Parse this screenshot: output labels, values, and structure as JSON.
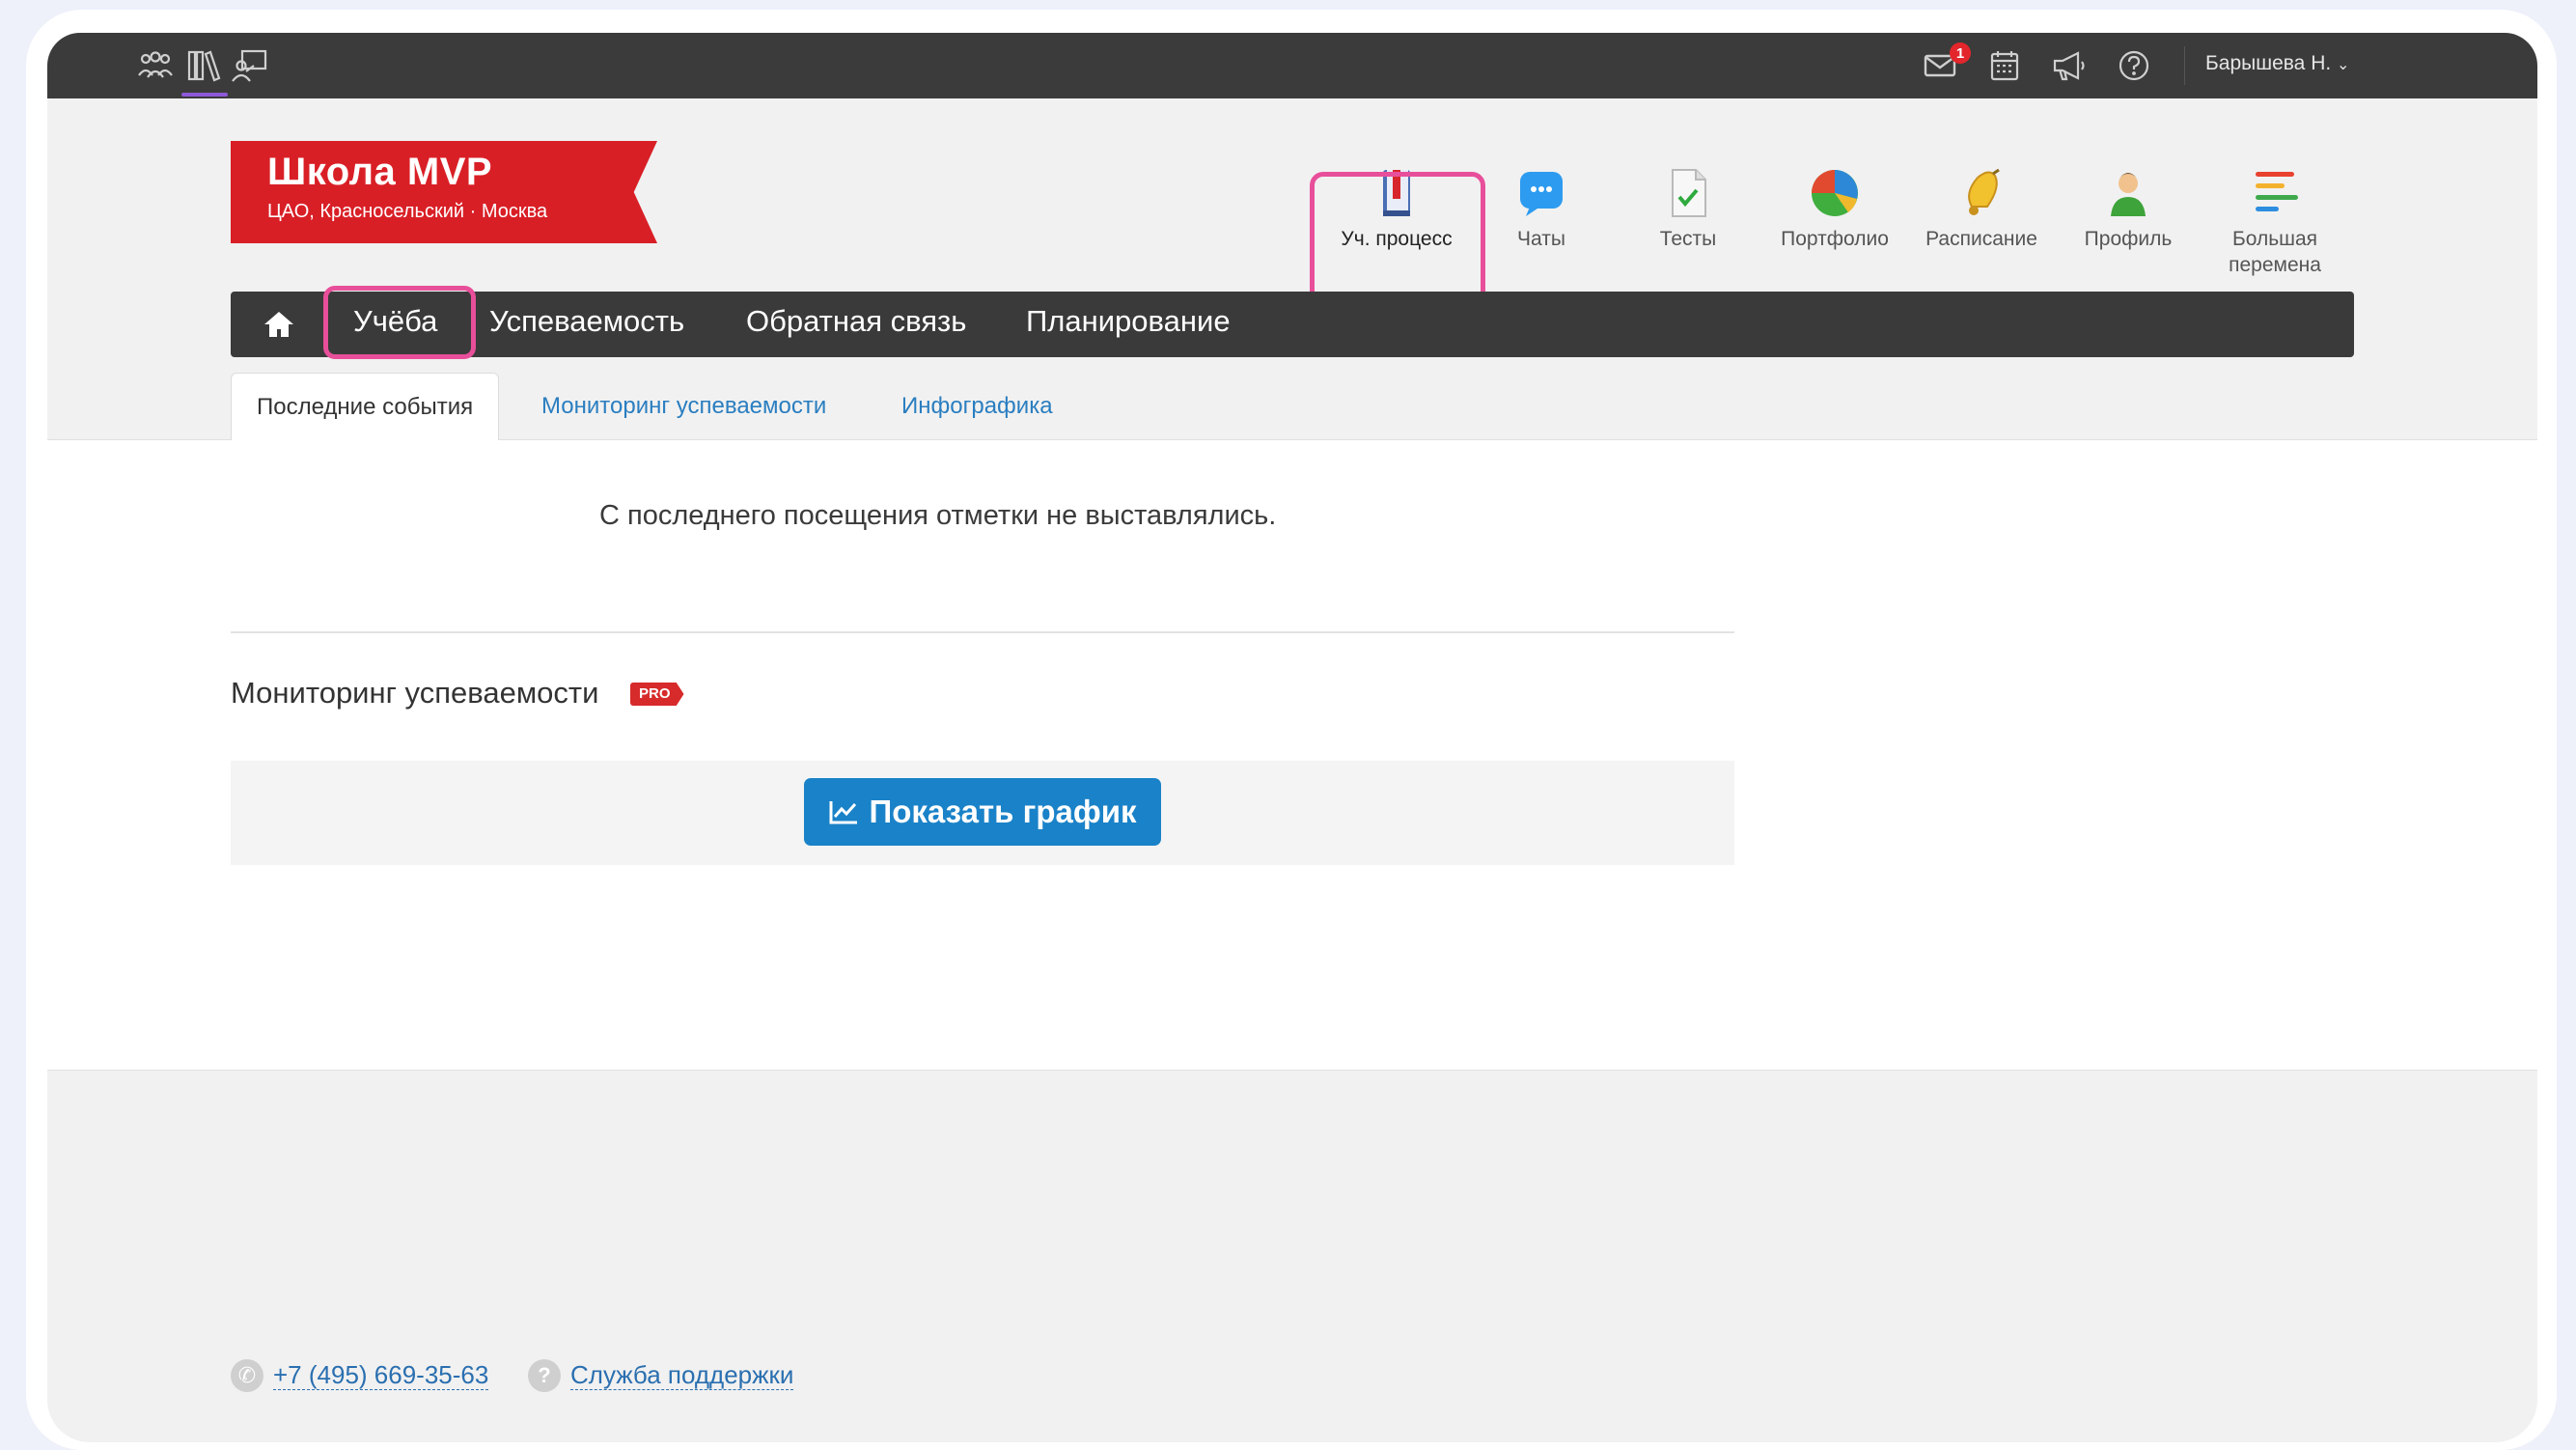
{
  "topbar": {
    "mail_badge": "1",
    "user_name": "Барышева Н.",
    "icons": [
      "people-icon",
      "books-icon",
      "teacher-icon",
      "mail-icon",
      "calendar-icon",
      "megaphone-icon",
      "help-icon"
    ]
  },
  "logo": {
    "title": "Школа MVP",
    "subtitle": "ЦАО, Красносельский · Москва"
  },
  "apps": [
    {
      "label": "Уч. процесс",
      "icon": "book-icon"
    },
    {
      "label": "Чаты",
      "icon": "chat-icon"
    },
    {
      "label": "Тесты",
      "icon": "test-icon"
    },
    {
      "label": "Портфолио",
      "icon": "pie-chart-icon"
    },
    {
      "label": "Расписание",
      "icon": "bell-icon"
    },
    {
      "label": "Профиль",
      "icon": "profile-icon"
    },
    {
      "label": "Большая перемена",
      "icon": "bars-icon"
    }
  ],
  "nav": {
    "items": [
      "Учёба",
      "Успеваемость",
      "Обратная связь",
      "Планирование"
    ]
  },
  "tabs": [
    "Последние события",
    "Мониторинг успеваемости",
    "Инфографика"
  ],
  "content": {
    "notice": "С последнего посещения отметки не выставлялись.",
    "section_title": "Мониторинг успеваемости",
    "pro_label": "PRO",
    "show_chart_label": "Показать график"
  },
  "footer": {
    "phone": "+7 (495) 669-35-63",
    "support": "Служба поддержки"
  },
  "colors": {
    "brand_red": "#d91f26",
    "highlight_pink": "#e84f9a",
    "primary_blue": "#1a82c8",
    "dark_bar": "#3b3b3b"
  }
}
